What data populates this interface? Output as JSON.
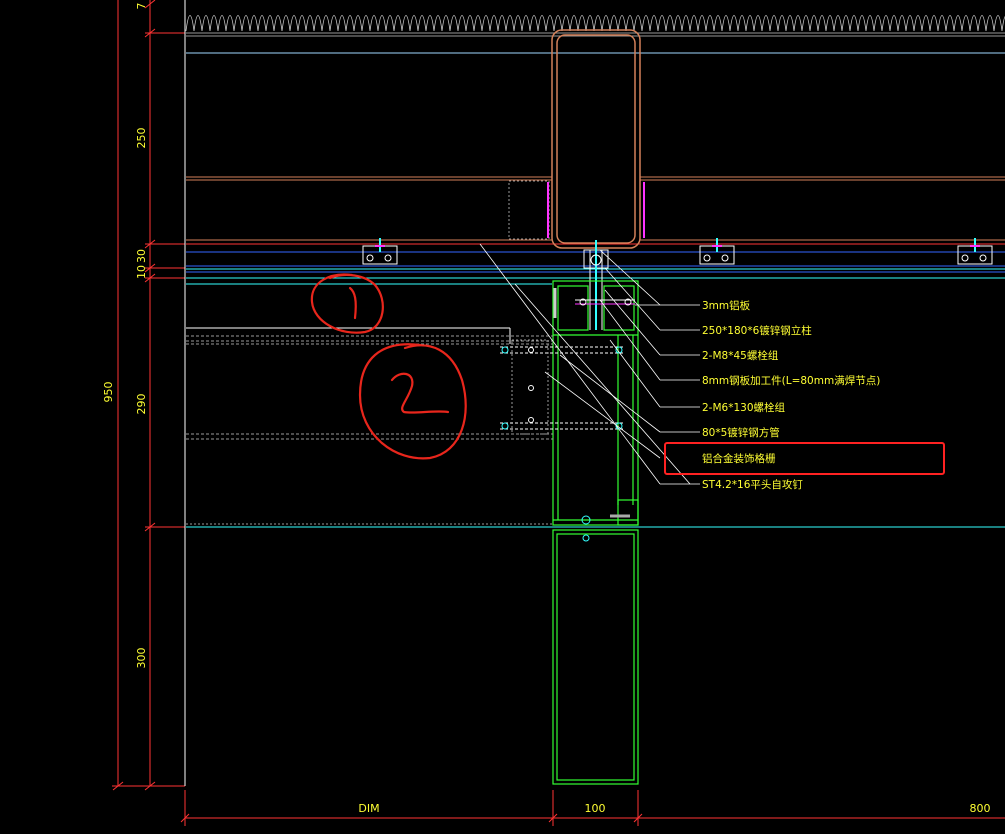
{
  "drawing": {
    "type": "CAD section detail",
    "colors": {
      "background": "#000000",
      "dimension_line": "#ff3333",
      "dimension_text": "#ffff33",
      "profile_green": "#33ff33",
      "steel_orange": "#d4815a",
      "cyan_line": "#33ffff",
      "blue_line": "#3366ff",
      "white_line": "#ffffff",
      "magenta": "#ff33ff",
      "highlight_box": "#ff2222",
      "handwriting": "#e8261c"
    }
  },
  "dimensions": {
    "vertical_left": "950",
    "vertical_segments": [
      "7",
      "250",
      "10",
      "30",
      "290",
      "300"
    ],
    "horizontal_bottom": [
      "DIM",
      "100",
      "800"
    ]
  },
  "callouts": [
    {
      "label": "3mm铝板"
    },
    {
      "label": "250*180*6镀锌钢立柱"
    },
    {
      "label": "2-M8*45螺栓组"
    },
    {
      "label": "8mm钢板加工件(L=80mm满焊节点)"
    },
    {
      "label": "2-M6*130螺栓组"
    },
    {
      "label": "80*5镀锌钢方管"
    },
    {
      "label": "铝合金装饰格栅",
      "highlighted": true
    },
    {
      "label": "ST4.2*16平头自攻钉"
    }
  ],
  "annotations": [
    {
      "label": "1",
      "type": "handwritten-circle"
    },
    {
      "label": "2",
      "type": "handwritten-circle"
    }
  ],
  "icons": [
    "bracket-clip-icon",
    "bolt-icon"
  ]
}
